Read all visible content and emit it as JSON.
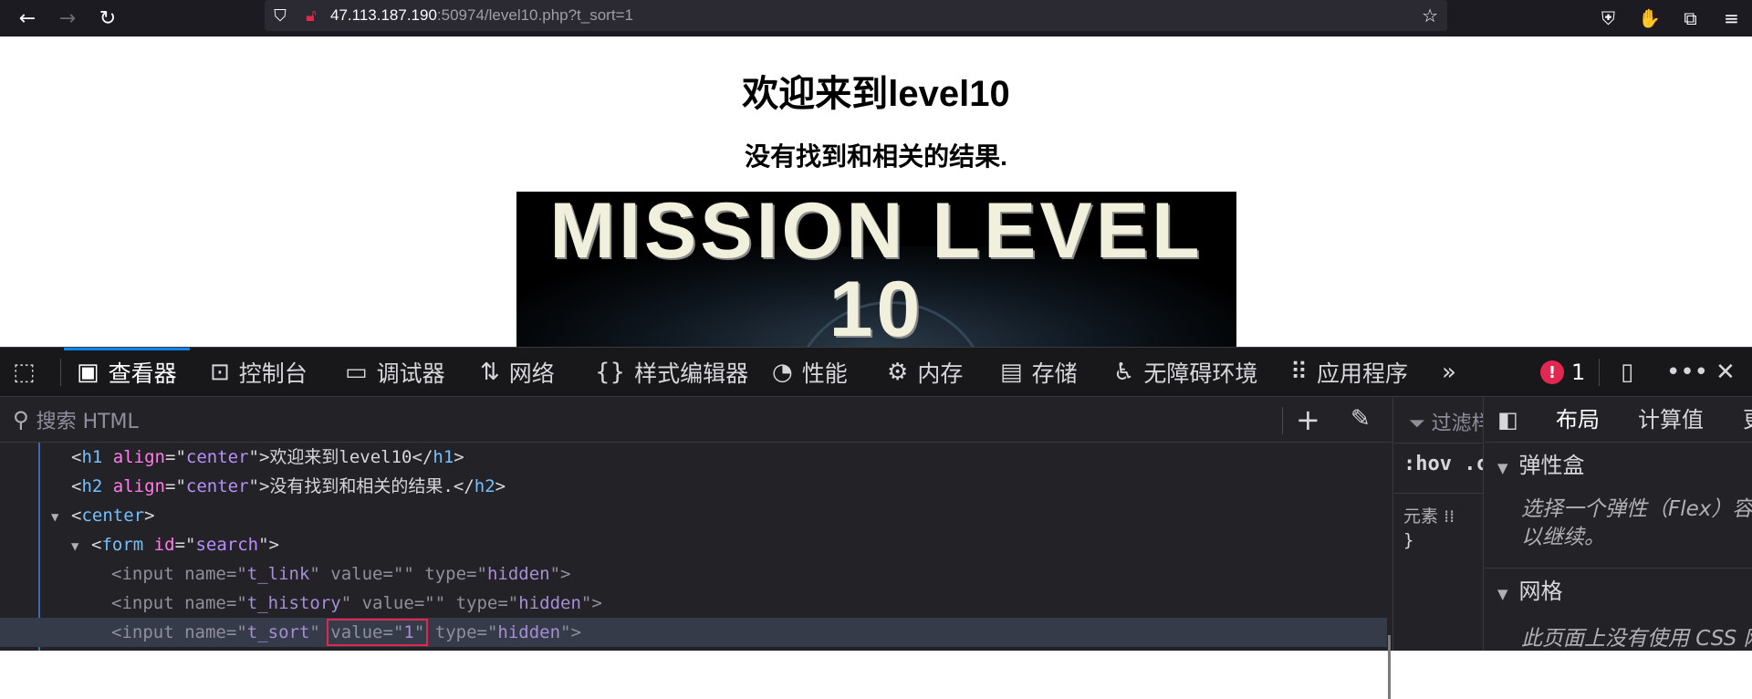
{
  "browser": {
    "url_host": "47.113.187.190",
    "url_rest": ":50974/level10.php?t_sort=1"
  },
  "page": {
    "heading": "欢迎来到level10",
    "subheading": "没有找到和相关的结果.",
    "banner_text": "MISSION LEVEL 10"
  },
  "devtools": {
    "tabs": [
      {
        "label": "查看器",
        "icon": "inspector-icon"
      },
      {
        "label": "控制台",
        "icon": "console-icon"
      },
      {
        "label": "调试器",
        "icon": "debugger-icon"
      },
      {
        "label": "网络",
        "icon": "network-icon"
      },
      {
        "label": "样式编辑器",
        "icon": "style-editor-icon"
      },
      {
        "label": "性能",
        "icon": "performance-icon"
      },
      {
        "label": "内存",
        "icon": "memory-icon"
      },
      {
        "label": "存储",
        "icon": "storage-icon"
      },
      {
        "label": "无障碍环境",
        "icon": "accessibility-icon"
      },
      {
        "label": "应用程序",
        "icon": "application-icon"
      }
    ],
    "error_count": "1",
    "search_placeholder": "搜索 HTML",
    "rules": {
      "filter": "过滤样式",
      "hov": ":hov .cls",
      "element": "元素",
      "brace": "}"
    },
    "layout": {
      "tab_layout": "布局",
      "tab_computed": "计算值",
      "tab_more": "更改",
      "flex_title": "弹性盒",
      "flex_text_1": "选择一个弹性（Flex）容器",
      "flex_text_2": "以继续。",
      "grid_title": "网格",
      "grid_text": "此页面上没有使用 CSS 网格"
    }
  },
  "markup": {
    "h1": {
      "tag": "h1",
      "attr": "align",
      "val": "center",
      "text": "欢迎来到level10"
    },
    "h2": {
      "tag": "h2",
      "attr": "align",
      "val": "center",
      "text": "没有找到和相关的结果."
    },
    "center": {
      "tag": "center"
    },
    "form": {
      "tag": "form",
      "attr": "id",
      "val": "search"
    },
    "inputs": [
      {
        "name": "t_link",
        "value": "",
        "type": "hidden"
      },
      {
        "name": "t_history",
        "value": "",
        "type": "hidden"
      },
      {
        "name": "t_sort",
        "value": "1",
        "type": "hidden"
      }
    ]
  }
}
